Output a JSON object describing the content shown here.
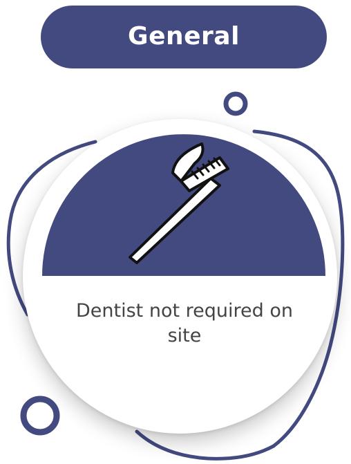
{
  "header": {
    "title": "General"
  },
  "card": {
    "caption": "Dentist not required on site",
    "icon": "toothbrush-icon"
  },
  "colors": {
    "brand": "#434a80",
    "text": "#444444",
    "background": "#ffffff"
  }
}
